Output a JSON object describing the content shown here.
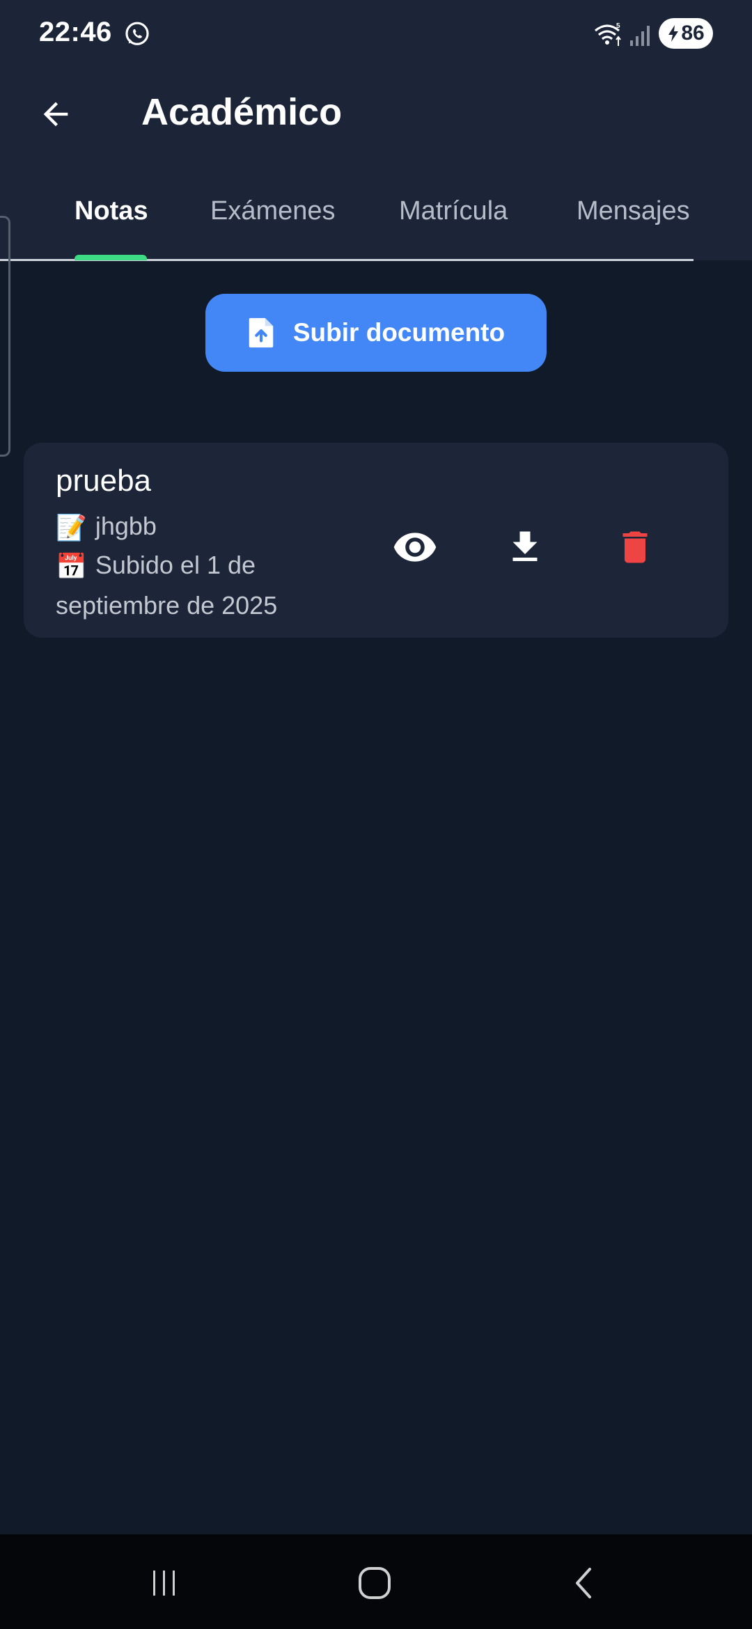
{
  "status_bar": {
    "time": "22:46",
    "battery": "86",
    "wifi_label": "5",
    "icons": [
      "whatsapp-icon",
      "wifi-icon",
      "signal-icon",
      "battery-icon"
    ]
  },
  "app_bar": {
    "title": "Académico",
    "back_icon": "arrow-left-icon"
  },
  "tabs": [
    {
      "label": "Notas",
      "active": true
    },
    {
      "label": "Exámenes",
      "active": false
    },
    {
      "label": "Matrícula",
      "active": false
    },
    {
      "label": "Mensajes",
      "active": false
    }
  ],
  "upload": {
    "label": "Subir documento",
    "icon": "file-upload-icon"
  },
  "documents": [
    {
      "title": "prueba",
      "description": "jhgbb",
      "date": "Subido el 1 de septiembre de 2025",
      "description_emoji": "📝",
      "date_emoji": "📅",
      "actions": [
        "eye-icon",
        "download-icon",
        "trash-icon"
      ]
    }
  ],
  "colors": {
    "background": "#101a29",
    "top_band": "#1b2537",
    "accent_blue": "#4387f6",
    "tab_indicator": "#3ddc84",
    "delete_red": "#ef4444"
  },
  "nav_bar": {
    "icons": [
      "recents-icon",
      "home-icon",
      "back-icon"
    ]
  }
}
